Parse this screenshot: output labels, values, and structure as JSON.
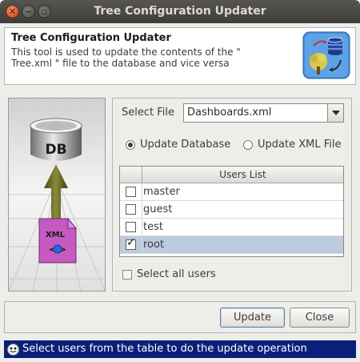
{
  "window": {
    "title": "Tree Configuration Updater"
  },
  "header": {
    "title": "Tree Configuration Updater",
    "description": "This tool is used to update the contents of the \" Tree.xml \" file to the database and vice versa",
    "icon": "database-tree-sync-icon"
  },
  "image_panel": {
    "db_label": "DB",
    "xml_label": "XML",
    "xml_tags": "< >"
  },
  "form": {
    "select_file_label": "Select File",
    "select_file_value": "Dashboards.xml",
    "radio_update_database": "Update Database",
    "radio_update_xml": "Update XML File",
    "selected_radio": "update_database"
  },
  "users_table": {
    "header": "Users List",
    "rows": [
      {
        "name": "master",
        "checked": false,
        "selected": false
      },
      {
        "name": "guest",
        "checked": false,
        "selected": false
      },
      {
        "name": "test",
        "checked": false,
        "selected": false
      },
      {
        "name": "root",
        "checked": true,
        "selected": true
      }
    ]
  },
  "select_all_label": "Select all users",
  "buttons": {
    "update": "Update",
    "close": "Close"
  },
  "status": {
    "text": "Select users from the table to do the update operation"
  },
  "colors": {
    "status_bg": "#0b1f7a",
    "selected_row": "#bccbdd",
    "title_bar": "#3e3d39"
  }
}
